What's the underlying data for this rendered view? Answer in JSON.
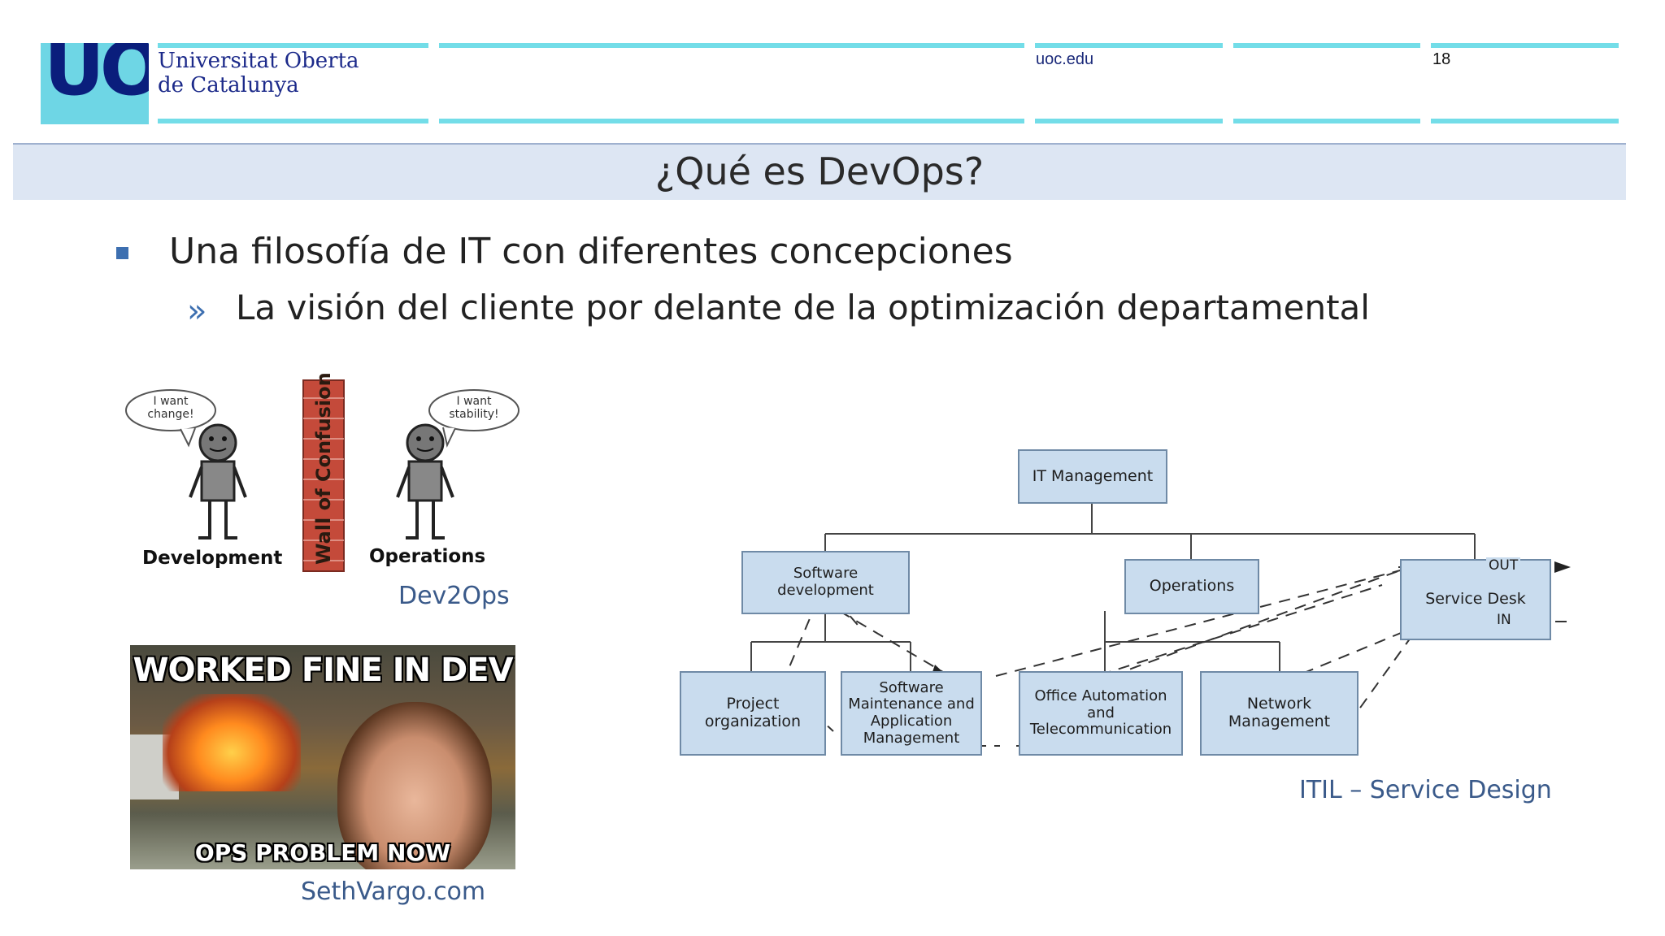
{
  "header": {
    "logo_text": "UOC",
    "university_line1": "Universitat Oberta",
    "university_line2": "de Catalunya",
    "site": "uoc.edu",
    "page_number": "18"
  },
  "slide": {
    "title": "¿Qué es DevOps?",
    "bullet_main": "Una filosofía de IT con diferentes concepciones",
    "bullet_sub": "La visión del cliente por delante de la optimización departamental"
  },
  "dev2ops": {
    "dev_speech": "I want change!",
    "ops_speech": "I want stability!",
    "wall_label": "Wall of Confusion",
    "dev_label": "Development",
    "ops_label": "Operations",
    "caption": "Dev2Ops"
  },
  "meme": {
    "top_text": "WORKED FINE IN DEV",
    "bottom_text": "OPS PROBLEM NOW",
    "caption": "SethVargo.com"
  },
  "itil": {
    "caption": "ITIL – Service Design",
    "nodes": {
      "it_management": "IT Management",
      "software_development": "Software development",
      "operations": "Operations",
      "service_desk": "Service Desk",
      "project_organization": "Project organization",
      "software_maintenance": "Software Maintenance and Application Management",
      "office_automation": "Office Automation and Telecommunication",
      "network_management": "Network Management"
    },
    "out_label": "OUT",
    "in_label": "IN"
  },
  "colors": {
    "accent_cyan": "#73dde8",
    "logo_navy": "#0a1e7c",
    "title_band": "#dde6f3",
    "bullet_blue": "#3d6fb0",
    "node_fill": "#c9dcee",
    "wall_brick": "#c44a3a"
  }
}
